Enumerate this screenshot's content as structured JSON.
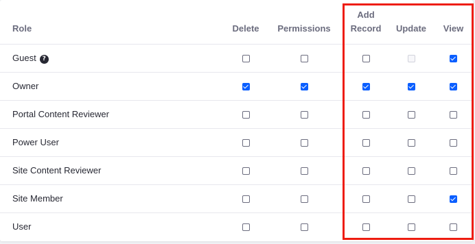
{
  "columns": {
    "role": "Role",
    "delete": "Delete",
    "permissions": "Permissions",
    "add_record_line1": "Add",
    "add_record_line2": "Record",
    "update": "Update",
    "view": "View"
  },
  "rows": [
    {
      "role": "Guest",
      "has_help": true,
      "delete": false,
      "permissions": false,
      "add_record": false,
      "update": "disabled",
      "view": true
    },
    {
      "role": "Owner",
      "has_help": false,
      "delete": true,
      "permissions": true,
      "add_record": true,
      "update": true,
      "view": true
    },
    {
      "role": "Portal Content Reviewer",
      "has_help": false,
      "delete": false,
      "permissions": false,
      "add_record": false,
      "update": false,
      "view": false
    },
    {
      "role": "Power User",
      "has_help": false,
      "delete": false,
      "permissions": false,
      "add_record": false,
      "update": false,
      "view": false
    },
    {
      "role": "Site Content Reviewer",
      "has_help": false,
      "delete": false,
      "permissions": false,
      "add_record": false,
      "update": false,
      "view": false
    },
    {
      "role": "Site Member",
      "has_help": false,
      "delete": false,
      "permissions": false,
      "add_record": false,
      "update": false,
      "view": true
    },
    {
      "role": "User",
      "has_help": false,
      "delete": false,
      "permissions": false,
      "add_record": false,
      "update": false,
      "view": false
    }
  ],
  "help_glyph": "?",
  "colors": {
    "checked": "#0b5fff",
    "highlight": "#ee1c10"
  }
}
